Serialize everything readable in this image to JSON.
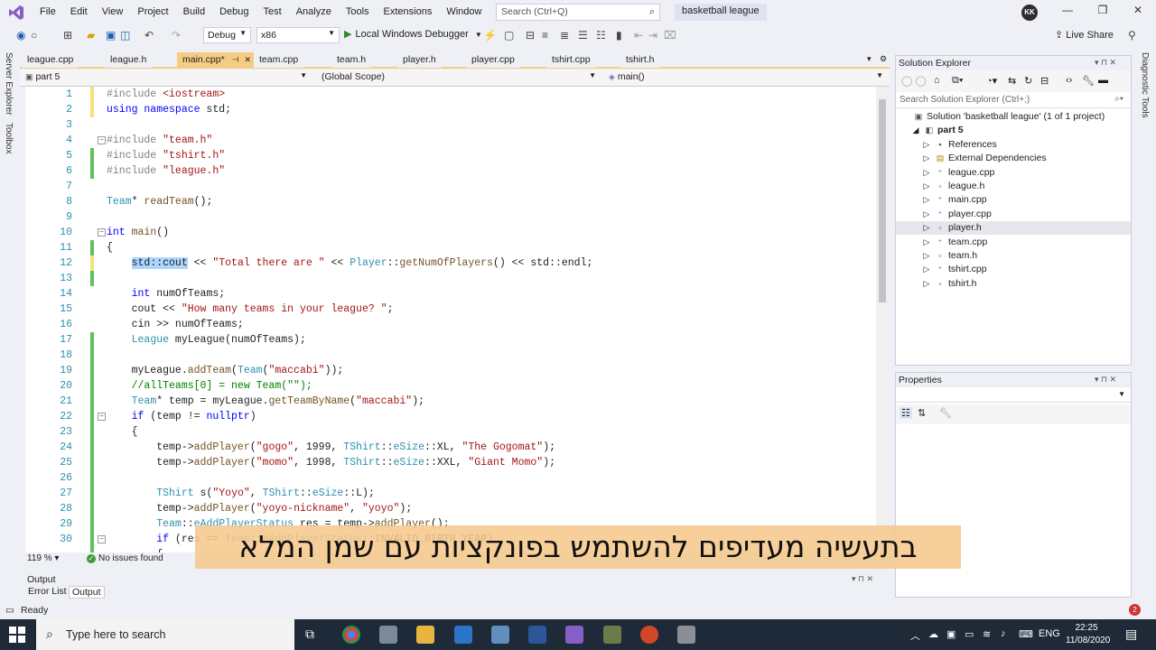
{
  "menu": [
    "File",
    "Edit",
    "View",
    "Project",
    "Build",
    "Debug",
    "Test",
    "Analyze",
    "Tools",
    "Extensions",
    "Window",
    "Help"
  ],
  "search": {
    "placeholder": "Search (Ctrl+Q)"
  },
  "solution_name": "basketball league",
  "avatar": "KK",
  "toolbar": {
    "config": "Debug",
    "platform": "x86",
    "debugger": "Local Windows Debugger",
    "liveshare": "Live Share"
  },
  "left_tabs": [
    "Server Explorer",
    "Toolbox"
  ],
  "right_tabs": [
    "Diagnostic Tools"
  ],
  "doc_tabs": [
    {
      "label": "league.cpp"
    },
    {
      "label": "league.h"
    },
    {
      "label": "main.cpp*"
    },
    {
      "label": "team.cpp"
    },
    {
      "label": "team.h"
    },
    {
      "label": "player.h"
    },
    {
      "label": "player.cpp"
    },
    {
      "label": "tshirt.cpp"
    },
    {
      "label": "tshirt.h"
    }
  ],
  "navbar": {
    "project": "part 5",
    "scope": "(Global Scope)",
    "member": "main()"
  },
  "code": [
    {
      "n": "1",
      "html": "<span class=\"pp\">#include</span> <span class=\"str\">&lt;iostream&gt;</span>",
      "chg": "y"
    },
    {
      "n": "2",
      "html": "<span class=\"kw\">using namespace</span> std;",
      "chg": "y"
    },
    {
      "n": "3",
      "html": "",
      "chg": ""
    },
    {
      "n": "4",
      "html": "<span class=\"pp\">#include</span> <span class=\"str\">\"team.h\"</span>",
      "chg": "",
      "fold": "⊟"
    },
    {
      "n": "5",
      "html": "<span class=\"pp\">#include</span> <span class=\"str\">\"tshirt.h\"</span>",
      "chg": "g"
    },
    {
      "n": "6",
      "html": "<span class=\"pp\">#include</span> <span class=\"str\">\"league.h\"</span>",
      "chg": "g"
    },
    {
      "n": "7",
      "html": "",
      "chg": ""
    },
    {
      "n": "8",
      "html": "<span class=\"ty\">Team</span>* <span class=\"fn\">readTeam</span>();",
      "chg": ""
    },
    {
      "n": "9",
      "html": "",
      "chg": ""
    },
    {
      "n": "10",
      "html": "<span class=\"kw\">int</span> <span class=\"fn\">main</span>()",
      "chg": "",
      "fold": "⊟"
    },
    {
      "n": "11",
      "html": "{",
      "chg": "g"
    },
    {
      "n": "12",
      "html": "    <span class=\"sel\">std::cout</span> &lt;&lt; <span class=\"str\">\"Total there are \"</span> &lt;&lt; <span class=\"ty\">Player</span>::<span class=\"fn\">getNumOfPlayers</span>() &lt;&lt; std::endl;",
      "chg": "y"
    },
    {
      "n": "13",
      "html": "",
      "chg": "g"
    },
    {
      "n": "14",
      "html": "    <span class=\"kw\">int</span> numOfTeams;",
      "chg": ""
    },
    {
      "n": "15",
      "html": "    cout &lt;&lt; <span class=\"str\">\"How many teams in your league? \"</span>;",
      "chg": ""
    },
    {
      "n": "16",
      "html": "    cin &gt;&gt; numOfTeams;",
      "chg": ""
    },
    {
      "n": "17",
      "html": "    <span class=\"ty\">League</span> myLeague(numOfTeams);",
      "chg": "g"
    },
    {
      "n": "18",
      "html": "",
      "chg": "g"
    },
    {
      "n": "19",
      "html": "    myLeague.<span class=\"fn\">addTeam</span>(<span class=\"ty\">Team</span>(<span class=\"str\">\"maccabi\"</span>));",
      "chg": "g"
    },
    {
      "n": "20",
      "html": "    <span class=\"cm\">//allTeams[0] = new Team(\"\");</span>",
      "chg": "g"
    },
    {
      "n": "21",
      "html": "    <span class=\"ty\">Team</span>* temp = myLeague.<span class=\"fn\">getTeamByName</span>(<span class=\"str\">\"maccabi\"</span>);",
      "chg": "g"
    },
    {
      "n": "22",
      "html": "    <span class=\"kw\">if</span> (temp != <span class=\"kw\">nullptr</span>)",
      "chg": "g",
      "fold": "⊟"
    },
    {
      "n": "23",
      "html": "    {",
      "chg": "g"
    },
    {
      "n": "24",
      "html": "        temp-&gt;<span class=\"fn\">addPlayer</span>(<span class=\"str\">\"gogo\"</span>, 1999, <span class=\"ty\">TShirt</span>::<span class=\"ty\">eSize</span>::XL, <span class=\"str\">\"The Gogomat\"</span>);",
      "chg": "g"
    },
    {
      "n": "25",
      "html": "        temp-&gt;<span class=\"fn\">addPlayer</span>(<span class=\"str\">\"momo\"</span>, 1998, <span class=\"ty\">TShirt</span>::<span class=\"ty\">eSize</span>::XXL, <span class=\"str\">\"Giant Momo\"</span>);",
      "chg": "g"
    },
    {
      "n": "26",
      "html": "",
      "chg": "g"
    },
    {
      "n": "27",
      "html": "        <span class=\"ty\">TShirt</span> s(<span class=\"str\">\"Yoyo\"</span>, <span class=\"ty\">TShirt</span>::<span class=\"ty\">eSize</span>::L);",
      "chg": "g"
    },
    {
      "n": "28",
      "html": "        temp-&gt;<span class=\"fn\">addPlayer</span>(<span class=\"str\">\"yoyo-nickname\"</span>, <span class=\"str\">\"yoyo\"</span>);",
      "chg": "g"
    },
    {
      "n": "29",
      "html": "        <span class=\"ty\">Team</span>::<span class=\"ty\">eAddPlayerStatus</span> res = temp-&gt;<span class=\"fn\">addPlayer</span>();",
      "chg": "g"
    },
    {
      "n": "30",
      "html": "        <span class=\"kw\">if</span> (res == <span class=\"ty\">Team</span>::<span class=\"ty\">eAddPlayerStatus</span>::INVALID_BIRTH_YEAR)",
      "chg": "g",
      "fold": "⊟"
    },
    {
      "n": "",
      "html": "        {",
      "chg": "g"
    }
  ],
  "editor_status": {
    "zoom": "119 %",
    "issues": "No issues found"
  },
  "output": {
    "title": "Output",
    "tabs": [
      "Error List",
      "Output"
    ]
  },
  "solution_explorer": {
    "title": "Solution Explorer",
    "search_placeholder": "Search Solution Explorer (Ctrl+;)",
    "items": [
      {
        "label": "Solution 'basketball league' (1 of 1 project)",
        "indent": 0,
        "icon": "solution-icon",
        "glyph": "▣"
      },
      {
        "label": "part 5",
        "indent": 1,
        "icon": "project-icon",
        "glyph": "◧",
        "bold": true,
        "expander": "◢"
      },
      {
        "label": "References",
        "indent": 2,
        "icon": "references-icon",
        "glyph": "▪",
        "expander": "▷"
      },
      {
        "label": "External Dependencies",
        "indent": 2,
        "icon": "external-deps-icon",
        "glyph": "▤",
        "expander": "▷"
      },
      {
        "label": "league.cpp",
        "indent": 2,
        "icon": "cpp-file-icon",
        "glyph": "⁺",
        "expander": "▷"
      },
      {
        "label": "league.h",
        "indent": 2,
        "icon": "header-file-icon",
        "glyph": "▫",
        "expander": "▷"
      },
      {
        "label": "main.cpp",
        "indent": 2,
        "icon": "cpp-file-icon",
        "glyph": "⁺",
        "expander": "▷"
      },
      {
        "label": "player.cpp",
        "indent": 2,
        "icon": "cpp-file-icon",
        "glyph": "⁺",
        "expander": "▷"
      },
      {
        "label": "player.h",
        "indent": 2,
        "icon": "header-file-icon",
        "glyph": "▫",
        "expander": "▷",
        "hl": true
      },
      {
        "label": "team.cpp",
        "indent": 2,
        "icon": "cpp-file-icon",
        "glyph": "⁺",
        "expander": "▷"
      },
      {
        "label": "team.h",
        "indent": 2,
        "icon": "header-file-icon",
        "glyph": "▫",
        "expander": "▷"
      },
      {
        "label": "tshirt.cpp",
        "indent": 2,
        "icon": "cpp-file-icon",
        "glyph": "⁺",
        "expander": "▷"
      },
      {
        "label": "tshirt.h",
        "indent": 2,
        "icon": "header-file-icon",
        "glyph": "▫",
        "expander": "▷"
      }
    ]
  },
  "properties": {
    "title": "Properties"
  },
  "statusbar": {
    "text": "Ready"
  },
  "taskbar": {
    "search": "Type here to search",
    "lang": "ENG",
    "time": "22:25",
    "date": "11/08/2020",
    "notif": "2"
  },
  "subtitle": "בתעשיה מעדיפים להשתמש בפונקציות עם שמן המלא",
  "colors": {
    "accent": "#f5cc84",
    "change_green": "#5fc15f",
    "change_yellow": "#f5e37a",
    "taskbar": "#1f2a38"
  }
}
